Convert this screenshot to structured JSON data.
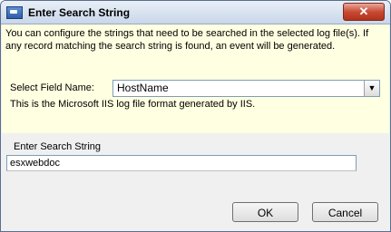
{
  "window": {
    "title": "Enter Search String",
    "close_glyph": "✕"
  },
  "info": {
    "text": "You can configure the strings that need to be searched in the selected log file(s). If any record matching the search string is found, an event will be generated."
  },
  "field": {
    "label": "Select Field Name:",
    "selected_value": "HostName",
    "description": "This is the Microsoft IIS log file format generated by IIS."
  },
  "search": {
    "label": "Enter Search String",
    "value": "esxwebdoc"
  },
  "buttons": {
    "ok": "OK",
    "cancel": "Cancel"
  },
  "icons": {
    "app": "window-icon",
    "dropdown": "chevron-down-icon",
    "close": "close-icon"
  }
}
